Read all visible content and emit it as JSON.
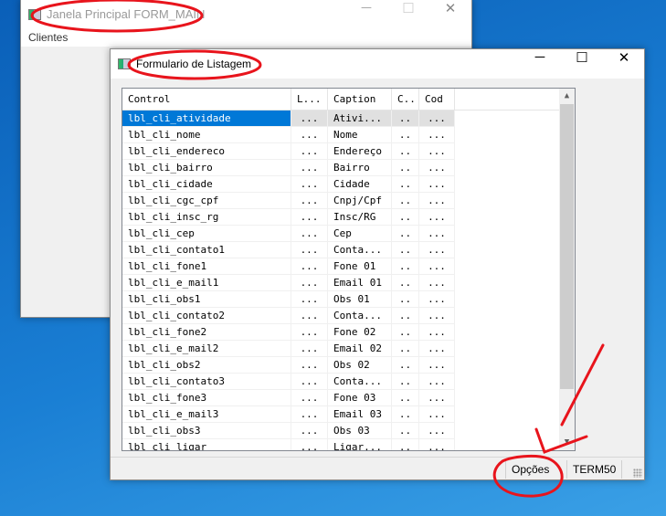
{
  "main_window": {
    "title": "Janela Principal FORM_MAIN",
    "menu": [
      "Clientes"
    ]
  },
  "dialog": {
    "title": "Formulario de Listagem",
    "columns": [
      "Control",
      "L...",
      "Caption",
      "C..",
      "Cod"
    ],
    "rows": [
      [
        "lbl_cli_atividade",
        "...",
        "Ativi...",
        "..",
        "..."
      ],
      [
        "lbl_cli_nome",
        "...",
        "Nome",
        "..",
        "..."
      ],
      [
        "lbl_cli_endereco",
        "...",
        "Endereço",
        "..",
        "..."
      ],
      [
        "lbl_cli_bairro",
        "...",
        "Bairro",
        "..",
        "..."
      ],
      [
        "lbl_cli_cidade",
        "...",
        "Cidade",
        "..",
        "..."
      ],
      [
        "lbl_cli_cgc_cpf",
        "...",
        "Cnpj/Cpf",
        "..",
        "..."
      ],
      [
        "lbl_cli_insc_rg",
        "...",
        "Insc/RG",
        "..",
        "..."
      ],
      [
        "lbl_cli_cep",
        "...",
        "Cep",
        "..",
        "..."
      ],
      [
        "lbl_cli_contato1",
        "...",
        "Conta...",
        "..",
        "..."
      ],
      [
        "lbl_cli_fone1",
        "...",
        "Fone 01",
        "..",
        "..."
      ],
      [
        "lbl_cli_e_mail1",
        "...",
        "Email 01",
        "..",
        "..."
      ],
      [
        "lbl_cli_obs1",
        "...",
        "Obs 01",
        "..",
        "..."
      ],
      [
        "lbl_cli_contato2",
        "...",
        "Conta...",
        "..",
        "..."
      ],
      [
        "lbl_cli_fone2",
        "...",
        "Fone 02",
        "..",
        "..."
      ],
      [
        "lbl_cli_e_mail2",
        "...",
        "Email 02",
        "..",
        "..."
      ],
      [
        "lbl_cli_obs2",
        "...",
        "Obs 02",
        "..",
        "..."
      ],
      [
        "lbl_cli_contato3",
        "...",
        "Conta...",
        "..",
        "..."
      ],
      [
        "lbl_cli_fone3",
        "...",
        "Fone 03",
        "..",
        "..."
      ],
      [
        "lbl_cli_e_mail3",
        "...",
        "Email 03",
        "..",
        "..."
      ],
      [
        "lbl_cli_obs3",
        "...",
        "Obs 03",
        "..",
        "..."
      ],
      [
        "lbl_cli_ligar",
        "...",
        "Ligar...",
        "..",
        "..."
      ]
    ],
    "status": {
      "options": "Opções",
      "terminal": "TERM50"
    }
  },
  "colors": {
    "selection": "#0078d7",
    "annotation": "#e8141c"
  }
}
